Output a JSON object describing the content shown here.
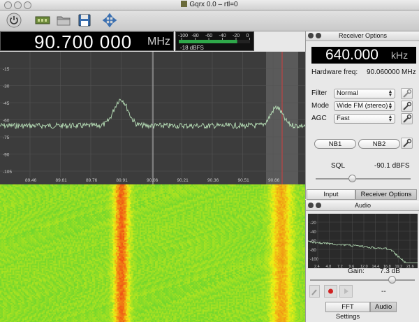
{
  "window": {
    "title": "Gqrx 0.0 – rtl=0"
  },
  "toolbar": {
    "buttons": [
      {
        "name": "power-icon"
      },
      {
        "name": "device-config-icon"
      },
      {
        "name": "open-folder-icon"
      },
      {
        "name": "save-icon"
      },
      {
        "name": "fullscreen-arrows-icon"
      }
    ]
  },
  "freq_display": {
    "value": "90.700 000",
    "unit": "MHz"
  },
  "meter": {
    "scale": [
      "-100",
      "-80",
      "-60",
      "-40",
      "-20",
      "0"
    ],
    "level_dbfs": "-18 dBFS",
    "level_fraction": 0.82
  },
  "spectrum": {
    "y_ticks": [
      "-15",
      "-30",
      "-45",
      "-60",
      "-75",
      "-90",
      "-105"
    ],
    "x_ticks": [
      "89.46",
      "89.61",
      "89.76",
      "89.91",
      "90.06",
      "90.21",
      "90.36",
      "90.51",
      "90.66"
    ],
    "colors": {
      "background": "#3c3c3c",
      "trace": "#b8e0b8",
      "grid": "#555555",
      "filter": "#5a5a5a",
      "center_line": "#c0c0c0",
      "demod_line": "#d04040"
    }
  },
  "receiver": {
    "panel_title": "Receiver Options",
    "offset_value": "640.000",
    "offset_unit": "kHz",
    "hw_freq_label": "Hardware freq:",
    "hw_freq_value": "90.060000 MHz",
    "filter_label": "Filter",
    "filter_value": "Normal",
    "mode_label": "Mode",
    "mode_value": "Wide FM (stereo)",
    "agc_label": "AGC",
    "agc_value": "Fast",
    "nb1": "NB1",
    "nb2": "NB2",
    "sql_label": "SQL",
    "sql_value": "-90.1 dBFS",
    "sql_fraction": 0.38
  },
  "tabs_top": [
    {
      "label": "Input controls",
      "active": false
    },
    {
      "label": "Receiver Options",
      "active": true
    }
  ],
  "audio": {
    "panel_title": "Audio",
    "fft_y_ticks": [
      "-20",
      "-40",
      "-60",
      "-80",
      "-100"
    ],
    "fft_x_ticks": [
      "2.4",
      "4.8",
      "7.2",
      "9.6",
      "12.0",
      "14.4",
      "16.8",
      "19.2",
      "21.6"
    ],
    "gain_label": "Gain:",
    "gain_value": "7.3 dB",
    "gain_fraction": 0.78,
    "rec_time": "--"
  },
  "tabs_bottom": [
    {
      "label": "FFT Settings",
      "active": false
    },
    {
      "label": "Audio",
      "active": true
    }
  ]
}
